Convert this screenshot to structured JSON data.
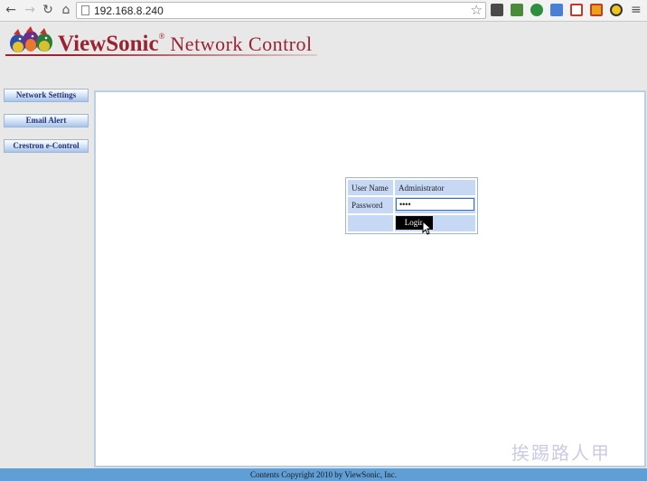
{
  "browser": {
    "back_icon": "←",
    "forward_icon": "→",
    "reload_icon": "↻",
    "home_icon": "⌂",
    "url": "192.168.8.240",
    "star_icon": "☆",
    "menu_icon": "≡"
  },
  "brand": {
    "name_bold": "ViewSonic",
    "registered": "®",
    "name_rest": " Network Control",
    "color": "#9b2231"
  },
  "sidebar": {
    "items": [
      {
        "label": "Network Settings"
      },
      {
        "label": "Email Alert"
      },
      {
        "label": "Crestron e-Control"
      }
    ]
  },
  "login": {
    "username_label": "User Name",
    "username_value": "Administrator",
    "password_label": "Password",
    "password_value": "••••",
    "submit_label": "Login"
  },
  "footer": {
    "text": "Contents Copyright 2010 by ViewSonic, Inc."
  },
  "watermark": {
    "text": "挨踢路人甲"
  }
}
